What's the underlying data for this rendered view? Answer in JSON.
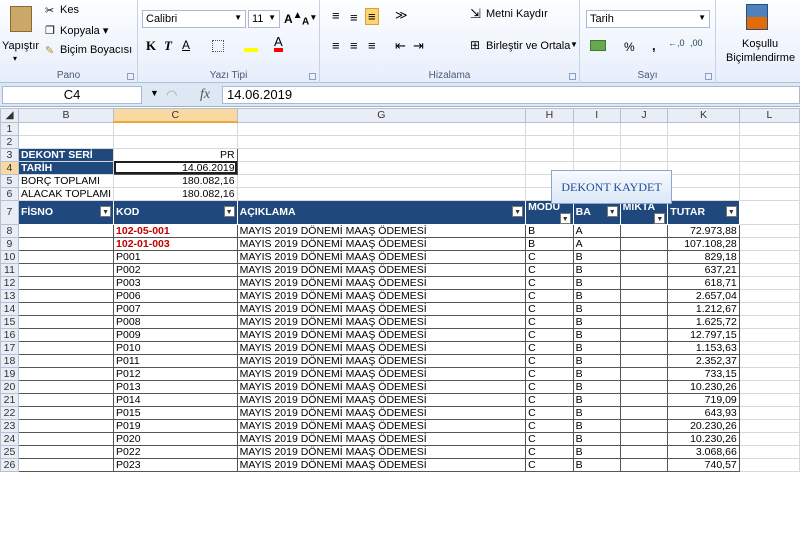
{
  "ribbon": {
    "paste_label": "Yapıştır",
    "cut_label": "Kes",
    "copy_label": "Kopyala",
    "copy_arrow": "▾",
    "format_painter_label": "Biçim Boyacısı",
    "clipboard_group": "Pano",
    "font_name": "Calibri",
    "font_size": "11",
    "font_group": "Yazı Tipi",
    "bold": "K",
    "italic": "T",
    "underline": "A",
    "align_group": "Hizalama",
    "wrap_label": "Metni Kaydır",
    "merge_label": "Birleştir ve Ortala",
    "number_format": "Tarih",
    "number_group": "Sayı",
    "percent": "%",
    "comma": ",",
    "cond_format_line1": "Koşullu",
    "cond_format_line2": "Biçimlendirme"
  },
  "formula_bar": {
    "name_box": "C4",
    "fx": "fx",
    "value": "14.06.2019"
  },
  "columns": [
    "B",
    "C",
    "G",
    "H",
    "I",
    "J",
    "K",
    "L"
  ],
  "rows": [
    {
      "n": "1"
    },
    {
      "n": "2"
    },
    {
      "n": "3",
      "b": "DEKONT SERİ",
      "c": "PR"
    },
    {
      "n": "4",
      "b": "TARİH",
      "c": "14.06.2019"
    },
    {
      "n": "5",
      "b": "BORÇ TOPLAMI",
      "c": "180.082,16"
    },
    {
      "n": "6",
      "b": "ALACAK TOPLAMI",
      "c": "180.082,16"
    }
  ],
  "headers": {
    "fisno": "FİSNO",
    "kod": "KOD",
    "aciklama": "AÇIKLAMA",
    "modul": "MODU",
    "ba": "BA",
    "miktar": "MİKTA",
    "tutar": "TUTAR",
    "filter": "▼"
  },
  "button": "DEKONT KAYDET",
  "data_rows": [
    {
      "n": "8",
      "kod": "102-05-001",
      "acik": "MAYIS 2019 DÖNEMİ MAAŞ ÖDEMESİ",
      "mod": "B",
      "ba": "A",
      "tutar": "72.973,88",
      "red": true
    },
    {
      "n": "9",
      "kod": "102-01-003",
      "acik": "MAYIS 2019 DÖNEMİ MAAŞ ÖDEMESİ",
      "mod": "B",
      "ba": "A",
      "tutar": "107.108,28",
      "red": true
    },
    {
      "n": "10",
      "kod": "P001",
      "acik": "MAYIS 2019 DÖNEMİ MAAŞ ÖDEMESİ",
      "mod": "C",
      "ba": "B",
      "tutar": "829,18"
    },
    {
      "n": "11",
      "kod": "P002",
      "acik": "MAYIS 2019 DÖNEMİ MAAŞ ÖDEMESİ",
      "mod": "C",
      "ba": "B",
      "tutar": "637,21"
    },
    {
      "n": "12",
      "kod": "P003",
      "acik": "MAYIS 2019 DÖNEMİ MAAŞ ÖDEMESİ",
      "mod": "C",
      "ba": "B",
      "tutar": "618,71"
    },
    {
      "n": "13",
      "kod": "P006",
      "acik": "MAYIS 2019 DÖNEMİ MAAŞ ÖDEMESİ",
      "mod": "C",
      "ba": "B",
      "tutar": "2.657,04"
    },
    {
      "n": "14",
      "kod": "P007",
      "acik": "MAYIS 2019 DÖNEMİ MAAŞ ÖDEMESİ",
      "mod": "C",
      "ba": "B",
      "tutar": "1.212,67"
    },
    {
      "n": "15",
      "kod": "P008",
      "acik": "MAYIS 2019 DÖNEMİ MAAŞ ÖDEMESİ",
      "mod": "C",
      "ba": "B",
      "tutar": "1.625,72"
    },
    {
      "n": "16",
      "kod": "P009",
      "acik": "MAYIS 2019 DÖNEMİ MAAŞ ÖDEMESİ",
      "mod": "C",
      "ba": "B",
      "tutar": "12.797,15"
    },
    {
      "n": "17",
      "kod": "P010",
      "acik": "MAYIS 2019 DÖNEMİ MAAŞ ÖDEMESİ",
      "mod": "C",
      "ba": "B",
      "tutar": "1.153,63"
    },
    {
      "n": "18",
      "kod": "P011",
      "acik": "MAYIS 2019 DÖNEMİ MAAŞ ÖDEMESİ",
      "mod": "C",
      "ba": "B",
      "tutar": "2.352,37"
    },
    {
      "n": "19",
      "kod": "P012",
      "acik": "MAYIS 2019 DÖNEMİ MAAŞ ÖDEMESİ",
      "mod": "C",
      "ba": "B",
      "tutar": "733,15"
    },
    {
      "n": "20",
      "kod": "P013",
      "acik": "MAYIS 2019 DÖNEMİ MAAŞ ÖDEMESİ",
      "mod": "C",
      "ba": "B",
      "tutar": "10.230,26"
    },
    {
      "n": "21",
      "kod": "P014",
      "acik": "MAYIS 2019 DÖNEMİ MAAŞ ÖDEMESİ",
      "mod": "C",
      "ba": "B",
      "tutar": "719,09"
    },
    {
      "n": "22",
      "kod": "P015",
      "acik": "MAYIS 2019 DÖNEMİ MAAŞ ÖDEMESİ",
      "mod": "C",
      "ba": "B",
      "tutar": "643,93"
    },
    {
      "n": "23",
      "kod": "P019",
      "acik": "MAYIS 2019 DÖNEMİ MAAŞ ÖDEMESİ",
      "mod": "C",
      "ba": "B",
      "tutar": "20.230,26"
    },
    {
      "n": "24",
      "kod": "P020",
      "acik": "MAYIS 2019 DÖNEMİ MAAŞ ÖDEMESİ",
      "mod": "C",
      "ba": "B",
      "tutar": "10.230,26"
    },
    {
      "n": "25",
      "kod": "P022",
      "acik": "MAYIS 2019 DÖNEMİ MAAŞ ÖDEMESİ",
      "mod": "C",
      "ba": "B",
      "tutar": "3.068,66"
    },
    {
      "n": "26",
      "kod": "P023",
      "acik": "MAYIS 2019 DÖNEMİ MAAŞ ÖDEMESİ",
      "mod": "C",
      "ba": "B",
      "tutar": "740,57"
    }
  ]
}
